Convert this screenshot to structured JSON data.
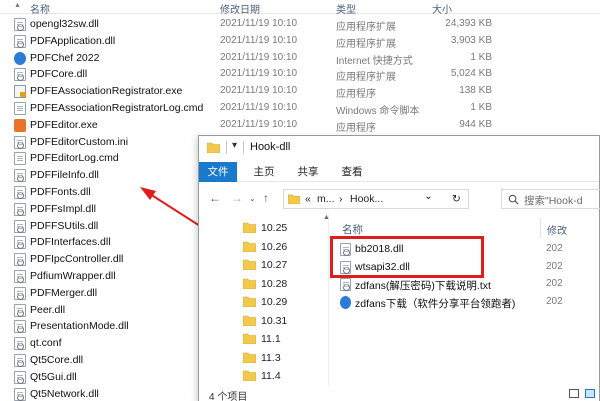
{
  "background_list": {
    "headers": {
      "name": "名称",
      "date": "修改日期",
      "type": "类型",
      "size": "大小"
    },
    "rows": [
      {
        "name": "opengl32sw.dll",
        "date": "2021/11/19 10:10",
        "type": "应用程序扩展",
        "size": "24,393 KB",
        "icon": "dll-file-icon"
      },
      {
        "name": "PDFApplication.dll",
        "date": "2021/11/19 10:10",
        "type": "应用程序扩展",
        "size": "3,903 KB",
        "icon": "dll-file-icon"
      },
      {
        "name": "PDFChef 2022",
        "date": "2021/11/19 10:10",
        "type": "Internet 快捷方式",
        "size": "1 KB",
        "icon": "internet-shortcut-icon"
      },
      {
        "name": "PDFCore.dll",
        "date": "2021/11/19 10:10",
        "type": "应用程序扩展",
        "size": "5,024 KB",
        "icon": "dll-file-icon"
      },
      {
        "name": "PDFEAssociationRegistrator.exe",
        "date": "2021/11/19 10:10",
        "type": "应用程序",
        "size": "138 KB",
        "icon": "exe-file-icon"
      },
      {
        "name": "PDFEAssociationRegistratorLog.cmd",
        "date": "2021/11/19 10:10",
        "type": "Windows 命令脚本",
        "size": "1 KB",
        "icon": "cmd-file-icon"
      },
      {
        "name": "PDFEditor.exe",
        "date": "2021/11/19 10:10",
        "type": "应用程序",
        "size": "944 KB",
        "icon": "app-exe-icon"
      },
      {
        "name": "PDFEditorCustom.ini",
        "date": "",
        "type": "",
        "size": "",
        "icon": "ini-file-icon"
      },
      {
        "name": "PDFEditorLog.cmd",
        "date": "",
        "type": "",
        "size": "",
        "icon": "cmd-file-icon"
      },
      {
        "name": "PDFFileInfo.dll",
        "date": "",
        "type": "",
        "size": "",
        "icon": "dll-file-icon"
      },
      {
        "name": "PDFFonts.dll",
        "date": "",
        "type": "",
        "size": "",
        "icon": "dll-file-icon"
      },
      {
        "name": "PDFFsImpl.dll",
        "date": "",
        "type": "",
        "size": "",
        "icon": "dll-file-icon"
      },
      {
        "name": "PDFFSUtils.dll",
        "date": "",
        "type": "",
        "size": "",
        "icon": "dll-file-icon"
      },
      {
        "name": "PDFInterfaces.dll",
        "date": "",
        "type": "",
        "size": "",
        "icon": "dll-file-icon"
      },
      {
        "name": "PDFIpcController.dll",
        "date": "",
        "type": "",
        "size": "",
        "icon": "dll-file-icon"
      },
      {
        "name": "PdfiumWrapper.dll",
        "date": "",
        "type": "",
        "size": "",
        "icon": "dll-file-icon"
      },
      {
        "name": "PDFMerger.dll",
        "date": "",
        "type": "",
        "size": "",
        "icon": "dll-file-icon"
      },
      {
        "name": "Peer.dll",
        "date": "",
        "type": "",
        "size": "",
        "icon": "dll-file-icon"
      },
      {
        "name": "PresentationMode.dll",
        "date": "",
        "type": "",
        "size": "",
        "icon": "dll-file-icon"
      },
      {
        "name": "qt.conf",
        "date": "",
        "type": "",
        "size": "",
        "icon": "conf-file-icon"
      },
      {
        "name": "Qt5Core.dll",
        "date": "",
        "type": "",
        "size": "",
        "icon": "dll-file-icon"
      },
      {
        "name": "Qt5Gui.dll",
        "date": "",
        "type": "",
        "size": "",
        "icon": "dll-file-icon"
      },
      {
        "name": "Qt5Network.dll",
        "date": "",
        "type": "",
        "size": "",
        "icon": "dll-file-icon"
      }
    ]
  },
  "window": {
    "title": "Hook-dll",
    "pin_glyph": "▾",
    "ribbon_tabs": [
      "文件",
      "主页",
      "共享",
      "查看"
    ],
    "address": {
      "overflow": "«",
      "seg1": "m...",
      "seg2": "Hook...",
      "chevron": "⌄",
      "refresh": "↻"
    },
    "search_placeholder": "搜索\"Hook-d",
    "nav_buttons": {
      "back": "←",
      "forward": "→",
      "up": "↑"
    },
    "nav_folders": [
      "10.25",
      "10.26",
      "10.27",
      "10.28",
      "10.29",
      "10.31",
      "11.1",
      "11.3",
      "11.4"
    ],
    "content_headers": {
      "name": "名称",
      "date": "修改"
    },
    "files": [
      {
        "name": "bb2018.dll",
        "date": "202",
        "icon": "dll-file-icon"
      },
      {
        "name": "wtsapi32.dll",
        "date": "202",
        "icon": "dll-file-icon"
      },
      {
        "name": "zdfans(解压密码)下载说明.txt",
        "date": "202",
        "icon": "txt-file-icon"
      },
      {
        "name": "zdfans下载（软件分享平台领跑者)",
        "date": "202",
        "icon": "internet-shortcut-icon"
      }
    ],
    "status_text": "4 个项目"
  },
  "colors": {
    "accent": "#1979ca",
    "highlight_red": "#e01d1d",
    "folder": "#f2c94c"
  }
}
